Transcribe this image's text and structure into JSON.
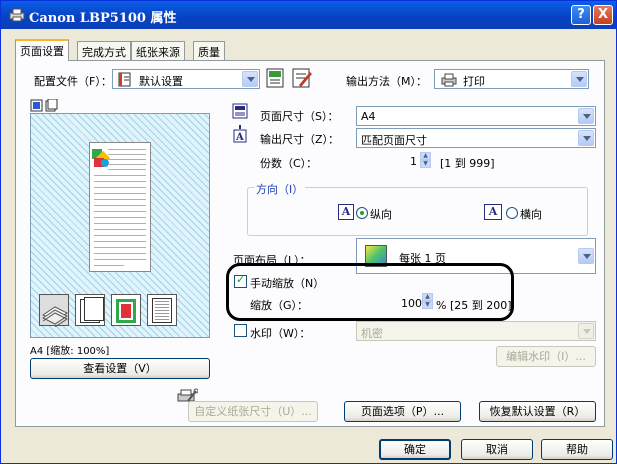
{
  "window": {
    "title": "Canon LBP5100 属性",
    "help_btn": "?",
    "close_btn": "X"
  },
  "tabs": [
    {
      "label": "页面设置"
    },
    {
      "label": "完成方式"
    },
    {
      "label": "纸张来源"
    },
    {
      "label": "质量"
    }
  ],
  "profile": {
    "label": "配置文件（F）：",
    "value": "默认设置"
  },
  "output_method": {
    "label": "输出方法（M）：",
    "value": "打印"
  },
  "preview": {
    "caption": "A4 [缩放: 100%]",
    "view_settings_btn": "查看设置（V）"
  },
  "page_size": {
    "label": "页面尺寸（S）：",
    "value": "A4"
  },
  "output_size": {
    "label": "输出尺寸（Z）：",
    "value": "匹配页面尺寸"
  },
  "copies": {
    "label": "份数（C）：",
    "value": "1",
    "range": "[1 到 999]"
  },
  "orientation": {
    "label": "方向（I）",
    "portrait_icon": "A",
    "portrait": "纵向",
    "landscape_icon": "A",
    "landscape": "横向"
  },
  "page_layout": {
    "label": "页面布局（L）：",
    "value": "每张 1 页"
  },
  "manual_scaling": {
    "label": "手动缩放（N）",
    "checked": true
  },
  "scaling": {
    "label": "缩放（G）：",
    "value": "100",
    "range": "% [25 到 200]"
  },
  "watermark": {
    "label": "水印（W）：",
    "value": "机密",
    "edit_btn": "编辑水印（I）..."
  },
  "buttons": {
    "custom_paper": "自定义纸张尺寸（U）...",
    "page_options": "页面选项（P）...",
    "restore_defaults": "恢复默认设置（R）",
    "ok": "确定",
    "cancel": "取消",
    "help": "帮助"
  },
  "colors": {
    "title_blue": "#0a4fd6",
    "window_bg": "#ece9d8",
    "panel_bg": "#fcfcfe",
    "highlight_oval": "#000000"
  }
}
